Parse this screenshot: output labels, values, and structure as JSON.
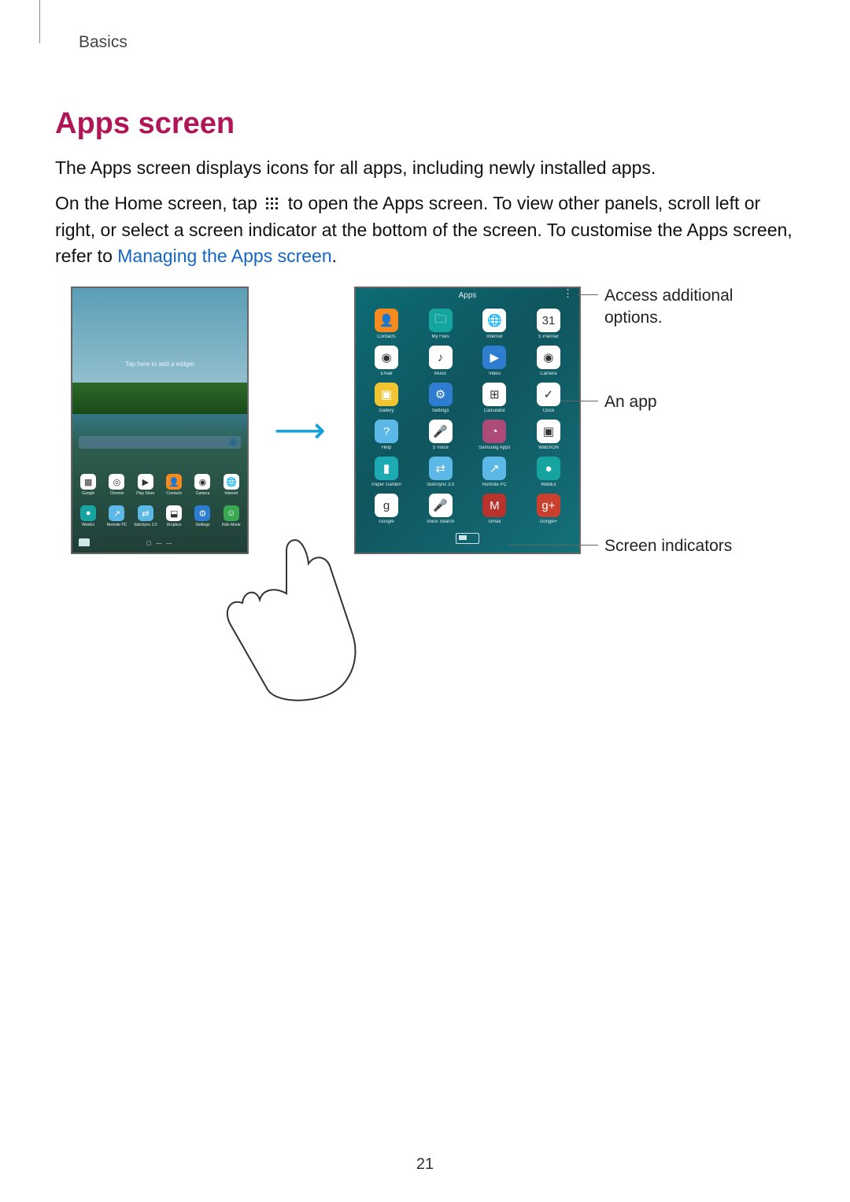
{
  "breadcrumb": "Basics",
  "heading": "Apps screen",
  "para1": "The Apps screen displays icons for all apps, including newly installed apps.",
  "para2_a": "On the Home screen, tap ",
  "para2_b": " to open the Apps screen. To view other panels, scroll left or right, or select a screen indicator at the bottom of the screen. To customise the Apps screen, refer to ",
  "link": "Managing the Apps screen",
  "period": ".",
  "home": {
    "hint": "Tap here to add a widget",
    "pager": "▢ — —",
    "dock1": [
      {
        "l": "Google",
        "c": "c-white",
        "g": "▦"
      },
      {
        "l": "Chrome",
        "c": "c-white",
        "g": "◎"
      },
      {
        "l": "Play Store",
        "c": "c-white",
        "g": "▶"
      },
      {
        "l": "Contacts",
        "c": "c-orange",
        "g": "👤"
      },
      {
        "l": "Camera",
        "c": "c-white",
        "g": "◉"
      },
      {
        "l": "Internet",
        "c": "c-white",
        "g": "🌐"
      }
    ],
    "dock2": [
      {
        "l": "WebEx",
        "c": "c-teal",
        "g": "●"
      },
      {
        "l": "Remote PC",
        "c": "c-lblue",
        "g": "↗"
      },
      {
        "l": "SideSync 3.0",
        "c": "c-lblue",
        "g": "⇄"
      },
      {
        "l": "Dropbox",
        "c": "c-white",
        "g": "⬓"
      },
      {
        "l": "Settings",
        "c": "c-blue",
        "g": "⚙"
      },
      {
        "l": "Kids Mode",
        "c": "c-green",
        "g": "☺"
      }
    ]
  },
  "apps": {
    "title": "Apps",
    "more": "⋮",
    "rows": [
      [
        {
          "l": "Contacts",
          "c": "c-orange",
          "g": "👤"
        },
        {
          "l": "My Files",
          "c": "c-teal",
          "g": "🗀"
        },
        {
          "l": "Internet",
          "c": "c-white",
          "g": "🌐"
        },
        {
          "l": "S Planner",
          "c": "c-white",
          "g": "31"
        }
      ],
      [
        {
          "l": "Email",
          "c": "c-white",
          "g": "◉"
        },
        {
          "l": "Music",
          "c": "c-white",
          "g": "♪"
        },
        {
          "l": "Video",
          "c": "c-blue",
          "g": "▶"
        },
        {
          "l": "Camera",
          "c": "c-white",
          "g": "◉"
        }
      ],
      [
        {
          "l": "Gallery",
          "c": "c-yellow",
          "g": "▣"
        },
        {
          "l": "Settings",
          "c": "c-blue",
          "g": "⚙"
        },
        {
          "l": "Calculator",
          "c": "c-white",
          "g": "⊞"
        },
        {
          "l": "Clock",
          "c": "c-white",
          "g": "✓"
        }
      ],
      [
        {
          "l": "Help",
          "c": "c-lblue",
          "g": "?"
        },
        {
          "l": "S Voice",
          "c": "c-white",
          "g": "🎤"
        },
        {
          "l": "Samsung Apps",
          "c": "c-pink",
          "g": "◔"
        },
        {
          "l": "WatchON",
          "c": "c-white",
          "g": "▣"
        }
      ],
      [
        {
          "l": "Paper Garden",
          "c": "c-cyan",
          "g": "▮"
        },
        {
          "l": "SideSync 3.0",
          "c": "c-lblue",
          "g": "⇄"
        },
        {
          "l": "Remote PC",
          "c": "c-lblue",
          "g": "↗"
        },
        {
          "l": "WebEx",
          "c": "c-teal",
          "g": "●"
        }
      ],
      [
        {
          "l": "Google",
          "c": "c-white",
          "g": "g"
        },
        {
          "l": "Voice Search",
          "c": "c-white",
          "g": "🎤"
        },
        {
          "l": "Gmail",
          "c": "c-dred",
          "g": "M"
        },
        {
          "l": "Google+",
          "c": "c-gplus",
          "g": "g+"
        }
      ]
    ]
  },
  "callouts": {
    "options": "Access additional options.",
    "app": "An app",
    "indicators": "Screen indicators"
  },
  "page_number": "21"
}
